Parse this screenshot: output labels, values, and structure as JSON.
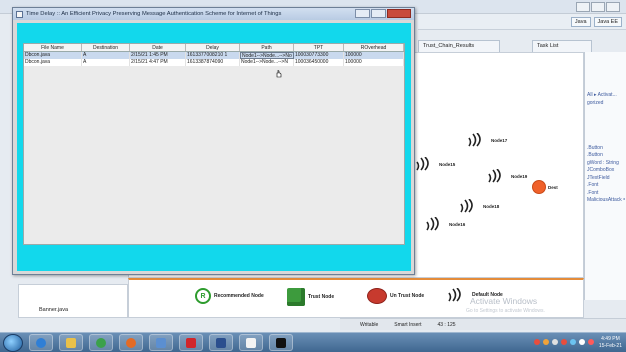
{
  "dialog": {
    "title": "Time Delay :: An Efficient Privacy Preserving Message Authentication Scheme for Internet of Things",
    "columns": [
      "File Name",
      "Destination",
      "Date",
      "Delay",
      "Path",
      "TPT",
      "ROverhead"
    ],
    "rows": [
      {
        "file": "Dbcon.java",
        "dest": "A",
        "date": "2/15/21 1:45 PM",
        "delay": "1613377008210 1",
        "path": "Node1-->Node...-->No",
        "tpt": "100030773300",
        "ro": "100000",
        "selected": true
      },
      {
        "file": "Dbcon.java",
        "dest": "A",
        "date": "2/15/21 4:47 PM",
        "delay": "1613387874090",
        "path": "Node1-->Node...-->N",
        "tpt": "100036450000",
        "ro": "100000",
        "selected": false
      }
    ]
  },
  "ide": {
    "perspective_label": "Java",
    "perspective_label2": "Java EE",
    "tabs": [
      "Trust_Chain_Results",
      "Task List"
    ],
    "task_lines": [
      "All ▸ Activat...",
      "gorized",
      "",
      "",
      "",
      "",
      "",
      ".Button",
      ".Button",
      "gWord : String",
      "JComboBox",
      "JTextField",
      ".Font",
      ".Font",
      "MaliciousAttack ="
    ]
  },
  "nodes": [
    {
      "label": "Node17"
    },
    {
      "label": "Node15"
    },
    {
      "label": "Node19"
    },
    {
      "label": "Node18"
    },
    {
      "label": "Node16"
    }
  ],
  "dest_label": "Dest",
  "legend": {
    "recommended": "Recommended Node",
    "trust": "Trust Node",
    "untrust": "Un Trust Node",
    "default": "Default Node",
    "r_letter": "R"
  },
  "watermark": {
    "title": "Activate Windows",
    "sub": "Go to Settings to activate Windows."
  },
  "status": {
    "mode": "Writable",
    "insert": "Smart Insert",
    "pos": "43 : 125"
  },
  "tree": {
    "file": "Banner.java"
  },
  "clock": {
    "time": "4:49 PM",
    "date": "15-Feb-21"
  },
  "colors": {
    "dialog_bg": "#12d8ec",
    "dest": "#f0612a",
    "legend_accent": "#e48c3a"
  }
}
